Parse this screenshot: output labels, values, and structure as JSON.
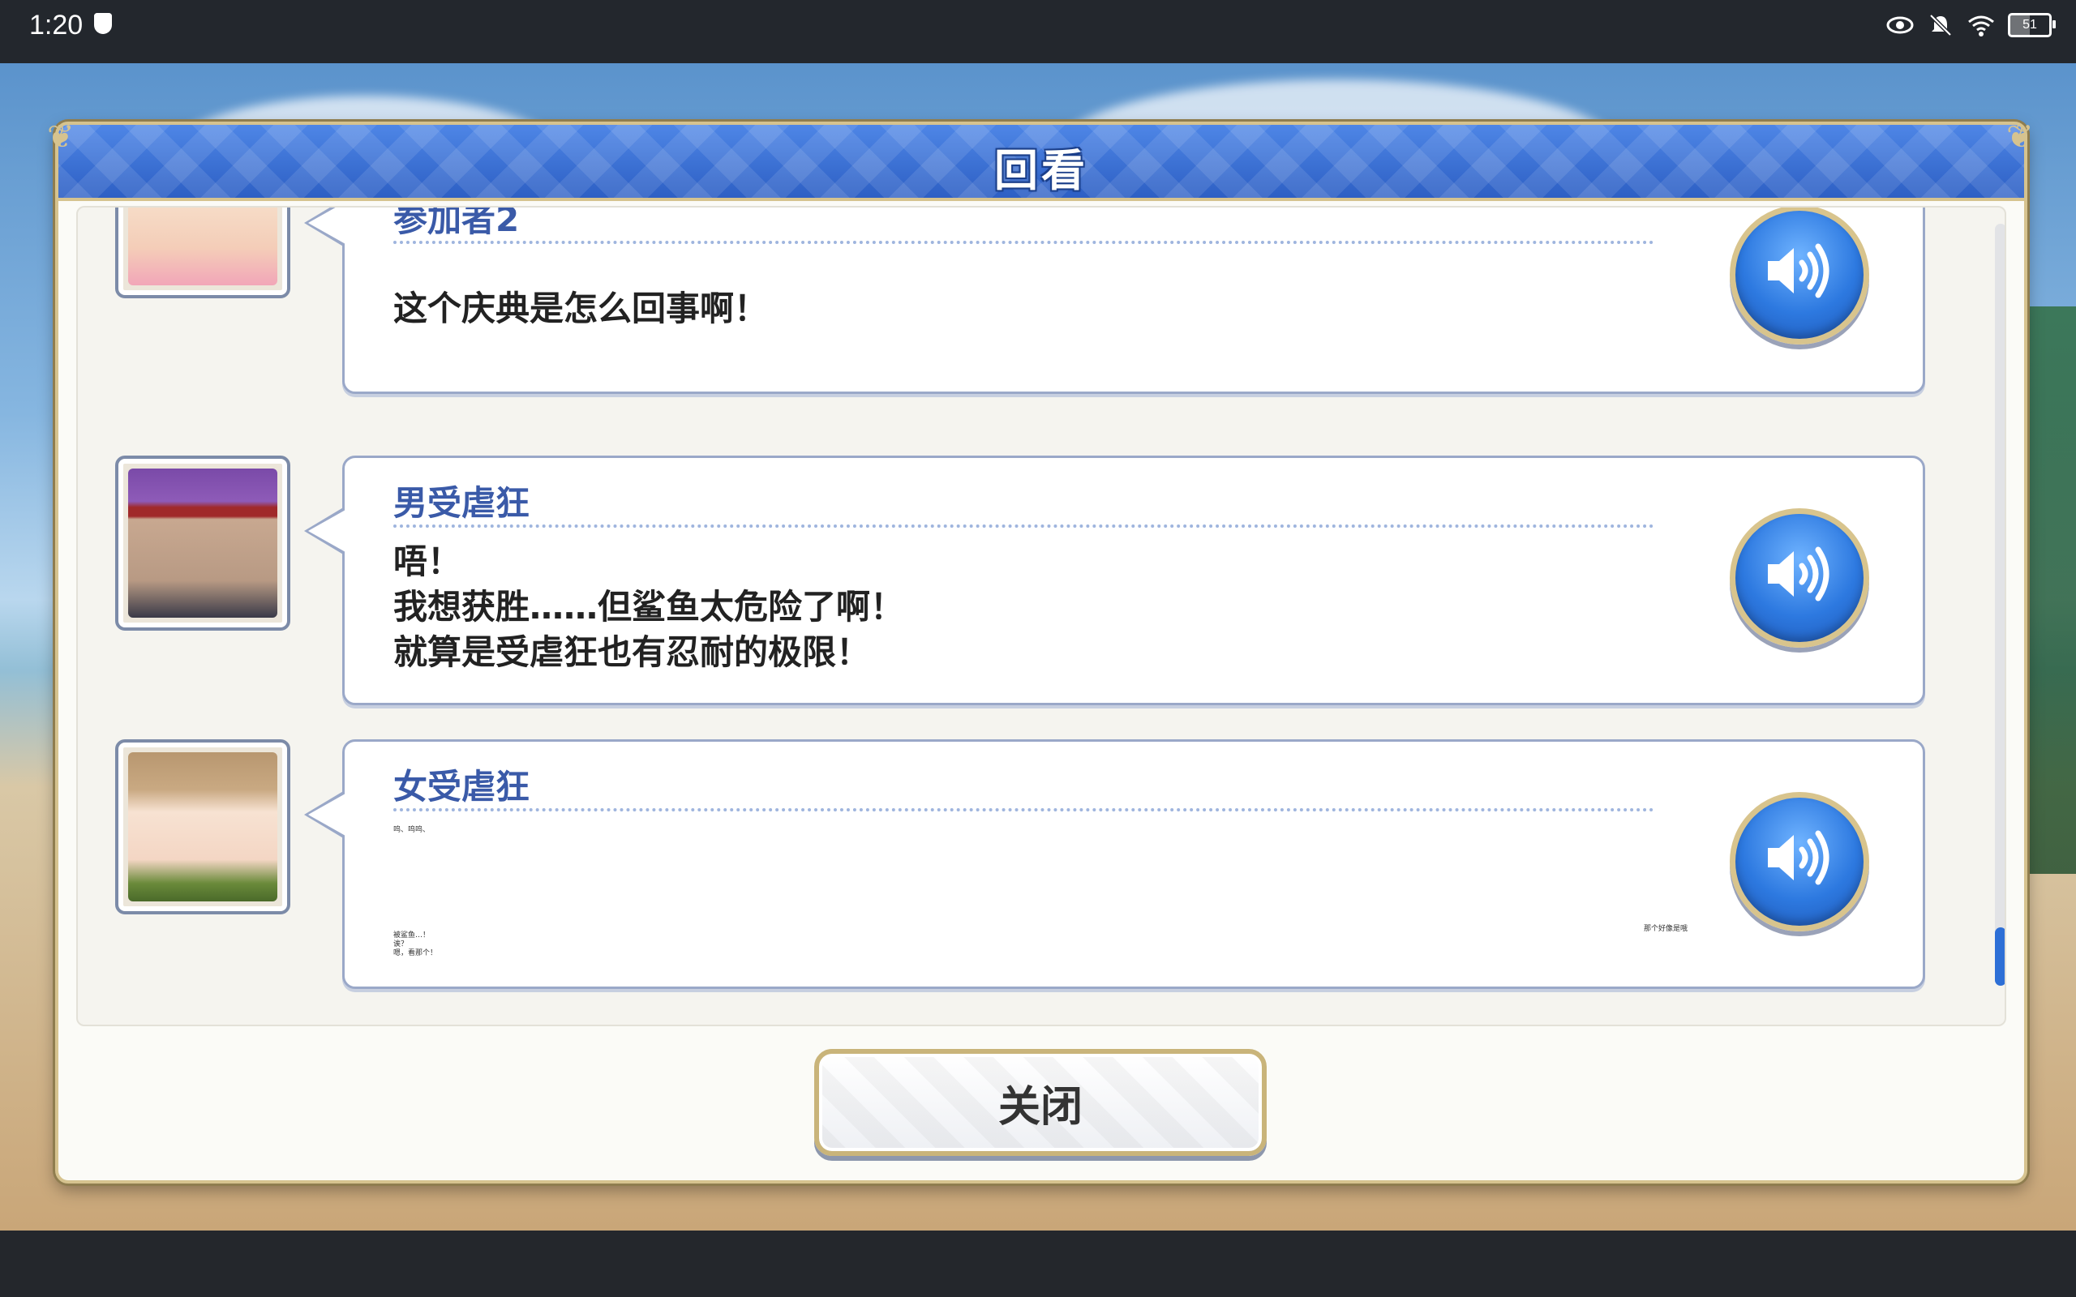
{
  "status_bar": {
    "time": "1:20",
    "battery": "51",
    "icons": [
      "shield-icon",
      "eye-icon",
      "bell-off-icon",
      "wifi-icon",
      "battery-icon"
    ]
  },
  "dialog": {
    "title": "回看",
    "close_label": "关闭",
    "entries": [
      {
        "speaker": "参加者2",
        "lines": [
          "这个庆典是怎么回事啊！"
        ],
        "voice_icon": "speaker-icon"
      },
      {
        "speaker": "男受虐狂",
        "lines": [
          "唔！",
          "我想获胜……但鲨鱼太危险了啊！",
          "就算是受虐狂也有忍耐的极限！"
        ],
        "voice_icon": "speaker-icon"
      },
      {
        "speaker": "女受虐狂",
        "lines": [
          "呜、呜呜、"
        ],
        "lines_bottom": [
          "被鲨鱼…！",
          "诶？",
          "嗯，看那个！"
        ],
        "side_note": "那个好像是哦",
        "voice_icon": "speaker-icon"
      }
    ]
  },
  "colors": {
    "header_blue": "#2d5fc4",
    "speaker_blue": "#3a5aa8",
    "gold_border": "#d6c38f",
    "scroll_thumb": "#2d6fd6"
  }
}
